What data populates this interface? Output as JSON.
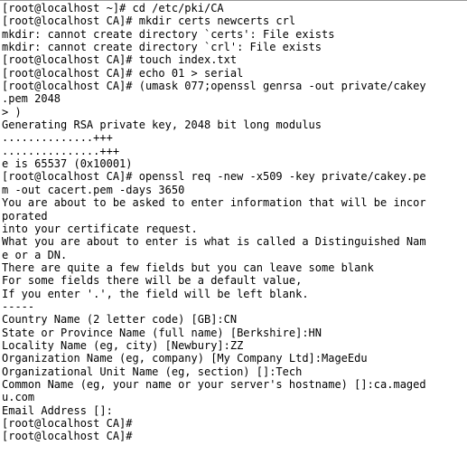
{
  "terminal": {
    "background_color": "#ffffff",
    "text_color": "#000000",
    "border_color": "#999999",
    "columns": 64,
    "lines": [
      "[root@localhost ~]# cd /etc/pki/CA",
      "[root@localhost CA]# mkdir certs newcerts crl",
      "mkdir: cannot create directory `certs': File exists",
      "mkdir: cannot create directory `crl': File exists",
      "[root@localhost CA]# touch index.txt",
      "[root@localhost CA]# echo 01 > serial",
      "[root@localhost CA]# (umask 077;openssl genrsa -out private/cakey",
      ".pem 2048",
      "> )",
      "Generating RSA private key, 2048 bit long modulus",
      "..............+++",
      "...............+++",
      "e is 65537 (0x10001)",
      "[root@localhost CA]# openssl req -new -x509 -key private/cakey.pe",
      "m -out cacert.pem -days 3650",
      "You are about to be asked to enter information that will be incor",
      "porated",
      "into your certificate request.",
      "What you are about to enter is what is called a Distinguished Nam",
      "e or a DN.",
      "There are quite a few fields but you can leave some blank",
      "For some fields there will be a default value,",
      "If you enter '.', the field will be left blank.",
      "-----",
      "Country Name (2 letter code) [GB]:CN",
      "State or Province Name (full name) [Berkshire]:HN",
      "Locality Name (eg, city) [Newbury]:ZZ",
      "Organization Name (eg, company) [My Company Ltd]:MageEdu",
      "Organizational Unit Name (eg, section) []:Tech",
      "Common Name (eg, your name or your server's hostname) []:ca.maged",
      "u.com",
      "Email Address []:",
      "[root@localhost CA]#",
      "[root@localhost CA]#"
    ]
  }
}
